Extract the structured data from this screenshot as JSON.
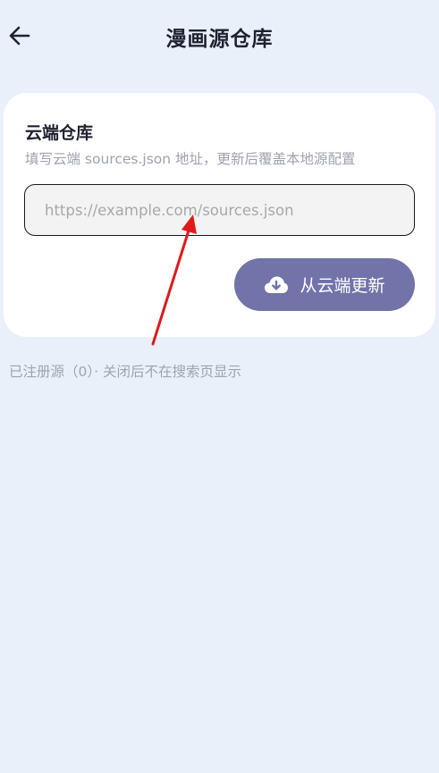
{
  "header": {
    "title": "漫画源仓库",
    "back_icon": "arrow-left-icon"
  },
  "cloud_repo": {
    "title": "云端仓库",
    "subtitle": "填写云端 sources.json 地址，更新后覆盖本地源配置",
    "url_input": {
      "value": "",
      "placeholder": "https://example.com/sources.json"
    },
    "update_button": {
      "label": "从云端更新",
      "icon": "cloud-download-icon"
    }
  },
  "status_text": "已注册源（0）· 关闭后不在搜索页显示",
  "colors": {
    "background": "#eaf0fa",
    "card": "#ffffff",
    "button": "#7173a9",
    "annotation_arrow": "#e0191b"
  }
}
